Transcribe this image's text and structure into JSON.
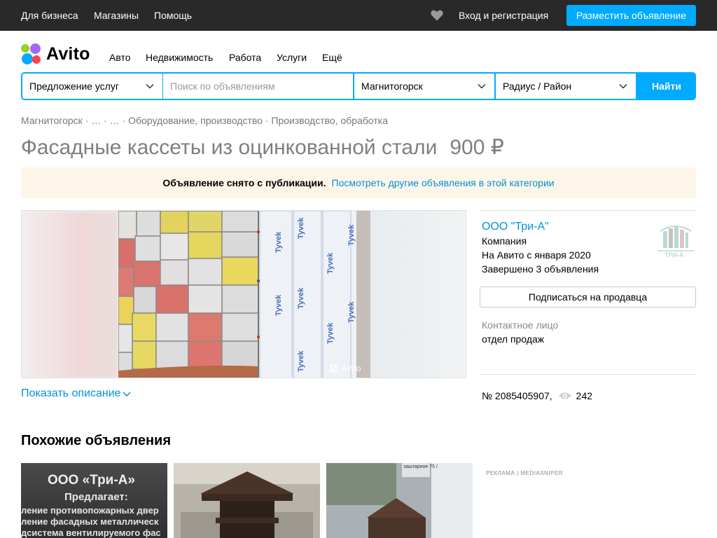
{
  "topbar": {
    "links": [
      "Для бизнеса",
      "Магазины",
      "Помощь"
    ],
    "login": "Вход и регистрация",
    "post_button": "Разместить объявление"
  },
  "logo": {
    "text": "Avito"
  },
  "nav": [
    "Авто",
    "Недвижимость",
    "Работа",
    "Услуги",
    "Ещё"
  ],
  "search": {
    "category": "Предложение услуг",
    "query_placeholder": "Поиск по объявлениям",
    "city": "Магнитогорск",
    "radius": "Радиус / Район",
    "find_button": "Найти"
  },
  "breadcrumb": [
    "Магнитогорск",
    "…",
    "…",
    "Оборудование, производство",
    "Производство, обработка"
  ],
  "listing": {
    "title": "Фасадные кассеты из оцинкованной стали",
    "price": "900 ₽"
  },
  "notice": {
    "text": "Объявление снято с публикации.",
    "link": "Посмотреть другие объявления в этой категории"
  },
  "gallery": {
    "watermark": "Avito"
  },
  "show_description": "Показать описание",
  "seller": {
    "name": "ООО \"Три-А\"",
    "type": "Компания",
    "since": "На Авито с января 2020",
    "completed": "Завершено 3 объявления",
    "logo_text": "ТРИ-А",
    "subscribe": "Подписаться на продавца",
    "contact_label": "Контактное лицо",
    "contact_value": "отдел продаж",
    "number": "№ 2085405907,",
    "views": "242"
  },
  "similar": {
    "title": "Похожие объявления",
    "card1": {
      "lines": [
        "ООО «Три-А»",
        "Предлагает:",
        "ление противопожарных двер",
        "ление фасадных металлическ",
        "дсистема вентилируемого фас"
      ]
    },
    "card3": {
      "sign": "заштарное 75 /"
    },
    "ad_label": "РЕКЛАМА | MEDIASNIPER"
  },
  "colors": {
    "accent": "#00aaff",
    "link": "#0091d9",
    "topbar": "#292929",
    "notice_bg": "#fdf6e8"
  }
}
